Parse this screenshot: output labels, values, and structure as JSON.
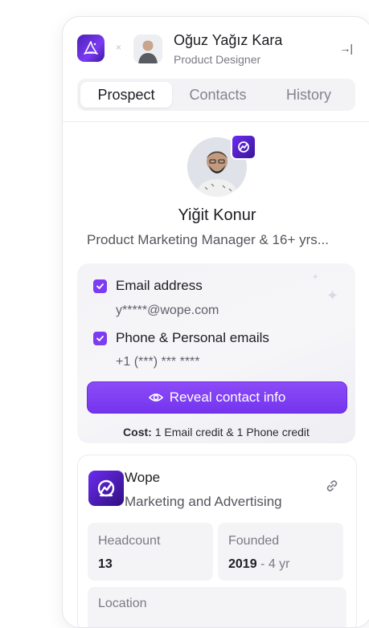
{
  "header": {
    "user_name": "Oğuz Yağız Kara",
    "user_role": "Product Designer",
    "separator": "×",
    "collapse_icon": "→|"
  },
  "tabs": [
    {
      "label": "Prospect",
      "active": true
    },
    {
      "label": "Contacts",
      "active": false
    },
    {
      "label": "History",
      "active": false
    }
  ],
  "profile": {
    "name": "Yiğit Konur",
    "headline": "Product Marketing Manager & 16+ yrs..."
  },
  "reveal": {
    "email_label": "Email address",
    "email_value": "y*****@wope.com",
    "phone_label": "Phone & Personal emails",
    "phone_value": "+1 (***) *** ****",
    "email_checked": true,
    "phone_checked": true,
    "button_label": "Reveal contact info",
    "cost_label": "Cost:",
    "cost_value": "1 Email credit & 1 Phone credit"
  },
  "company": {
    "name": "Wope",
    "industry": "Marketing and Advertising",
    "headcount_label": "Headcount",
    "headcount_value": "13",
    "founded_label": "Founded",
    "founded_year": "2019",
    "founded_sep": " - ",
    "founded_age": "4 yr",
    "location_label": "Location"
  },
  "colors": {
    "accent": "#7c3cf2",
    "brand_dark": "#3b1599"
  },
  "icons": {
    "app_logo": "wizard-hat-icon",
    "collapse": "collapse-panel-icon",
    "checkbox": "checkmark-icon",
    "eye": "eye-icon",
    "link": "link-icon",
    "company_logo": "wope-logo-icon"
  }
}
